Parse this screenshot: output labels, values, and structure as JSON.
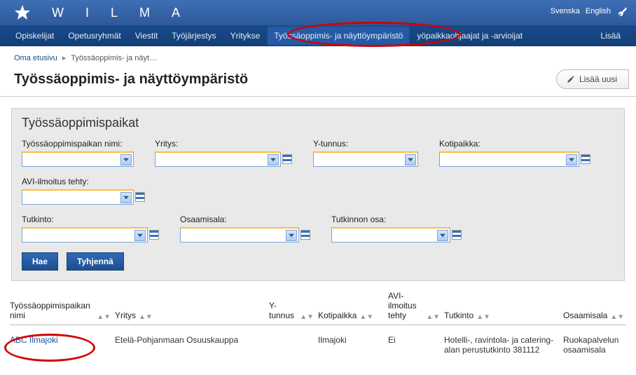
{
  "header": {
    "brand_letters": [
      "W",
      "I",
      "L",
      "M",
      "A"
    ],
    "lang_links": {
      "svenska": "Svenska",
      "english": "English"
    }
  },
  "nav": {
    "items": [
      {
        "label": "Opiskelijat"
      },
      {
        "label": "Opetusryhmät"
      },
      {
        "label": "Viestit"
      },
      {
        "label": "Työjärjestys"
      },
      {
        "label": "Yritykse"
      },
      {
        "label": "Työssäoppimis- ja näyttöympäristö",
        "active": true
      },
      {
        "label": "yöpaikkaohjaajat ja -arvioijat"
      },
      {
        "label": "Lisää"
      }
    ]
  },
  "breadcrumb": {
    "home": "Oma etusivu",
    "sep": "▸",
    "current": "Työssäoppimis- ja näyt…"
  },
  "page": {
    "title": "Työssäoppimis- ja näyttöympäristö",
    "add_label": "Lisää uusi"
  },
  "panel": {
    "heading": "Työssäoppimispaikat",
    "fields": {
      "name": "Työssäoppimispaikan nimi:",
      "company": "Yritys:",
      "businessid": "Y-tunnus:",
      "location": "Kotipaikka:",
      "avi": "AVI-ilmoitus tehty:",
      "degree": "Tutkinto:",
      "competence": "Osaamisala:",
      "degreepart": "Tutkinnon osa:"
    },
    "buttons": {
      "search": "Hae",
      "clear": "Tyhjennä"
    }
  },
  "table": {
    "headers": {
      "name": "Työssäoppimispaikan nimi",
      "company": "Yritys",
      "businessid": "Y-tunnus",
      "location": "Kotipaikka",
      "avi": "AVI-ilmoitus tehty",
      "degree": "Tutkinto",
      "competence": "Osaamisala"
    },
    "rows": [
      {
        "name": "ABC Ilmajoki",
        "company": "Etelä-Pohjanmaan Osuuskauppa",
        "businessid": "",
        "location": "Ilmajoki",
        "avi": "Ei",
        "degree": "Hotelli-, ravintola- ja catering-alan perustutkinto 381112",
        "competence": "Ruokapalvelun osaamisala"
      }
    ]
  }
}
